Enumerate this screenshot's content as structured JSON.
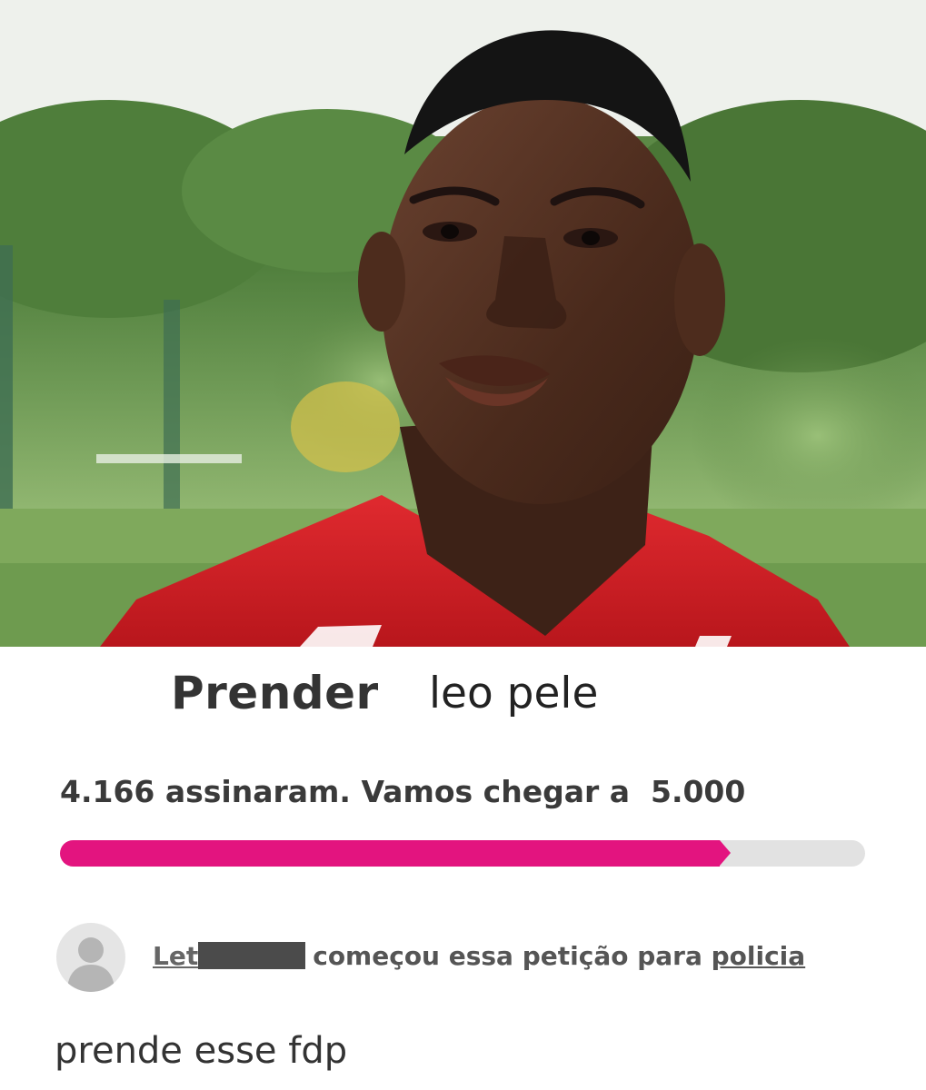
{
  "petition": {
    "title_action": "Prender",
    "title_name": "leo pele",
    "signatures_text": "4.166 assinaram. Vamos chegar a  5.000",
    "signatures": 4166,
    "goal": 5000,
    "starter_name_visible": "Let",
    "starter_action": "começou essa petição para",
    "target": "policia",
    "message": "prende esse fdp"
  },
  "colors": {
    "progress_fill": "#e3147f",
    "progress_track": "#e2e2e2",
    "jersey": "#d8232a"
  },
  "icons": {
    "avatar": "default-user-avatar-icon"
  }
}
